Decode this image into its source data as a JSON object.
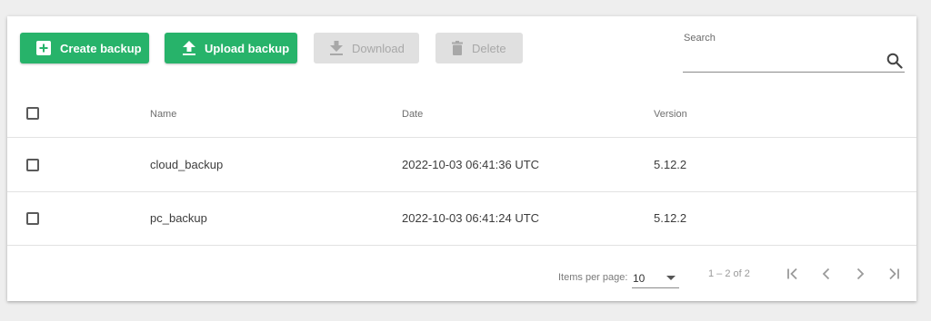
{
  "toolbar": {
    "create_label": "Create backup",
    "upload_label": "Upload backup",
    "download_label": "Download",
    "delete_label": "Delete"
  },
  "search": {
    "label": "Search",
    "value": ""
  },
  "table": {
    "columns": [
      "Name",
      "Date",
      "Version"
    ],
    "rows": [
      {
        "name": "cloud_backup",
        "date": "2022-10-03 06:41:36 UTC",
        "version": "5.12.2"
      },
      {
        "name": "pc_backup",
        "date": "2022-10-03 06:41:24 UTC",
        "version": "5.12.2"
      }
    ]
  },
  "paginator": {
    "items_label": "Items per page:",
    "page_size": "10",
    "range": "1 – 2 of 2"
  },
  "colors": {
    "primary": "#27b36a",
    "disabled_bg": "#e0e0e0",
    "disabled_text": "#a8a8a8"
  },
  "icons": {
    "create": "plus-box-icon",
    "upload": "upload-icon",
    "download": "download-icon",
    "delete": "trash-icon",
    "search": "search-icon",
    "first": "first-page-icon",
    "prev": "chevron-left-icon",
    "next": "chevron-right-icon",
    "last": "last-page-icon"
  }
}
